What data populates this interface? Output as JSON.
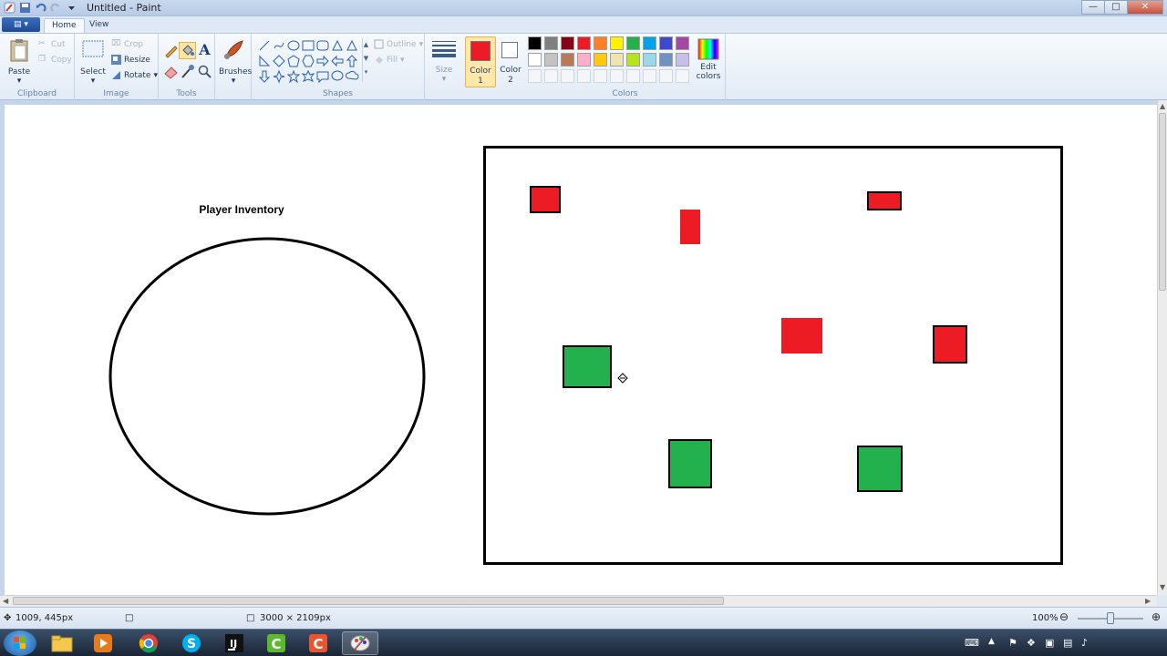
{
  "window": {
    "title": "Untitled - Paint"
  },
  "tabs": {
    "file_label": "▤ ▾",
    "home": "Home",
    "view": "View"
  },
  "ribbon": {
    "clipboard": {
      "group": "Clipboard",
      "paste": "Paste",
      "cut": "Cut",
      "copy": "Copy"
    },
    "image": {
      "group": "Image",
      "select": "Select",
      "crop": "Crop",
      "resize": "Resize",
      "rotate": "Rotate"
    },
    "tools": {
      "group": "Tools"
    },
    "brushes": {
      "label": "Brushes"
    },
    "shapes": {
      "group": "Shapes",
      "outline": "Outline",
      "fill": "Fill"
    },
    "size": {
      "label": "Size"
    },
    "color1": {
      "label": "Color",
      "num": "1",
      "value": "#ed1c24"
    },
    "color2": {
      "label": "Color",
      "num": "2",
      "value": "#ffffff"
    },
    "colors": {
      "group": "Colors",
      "edit_line1": "Edit",
      "edit_line2": "colors"
    },
    "palette_row1": [
      "#000000",
      "#7f7f7f",
      "#880015",
      "#ed1c24",
      "#ff7f27",
      "#fff200",
      "#22b14c",
      "#00a2e8",
      "#3f48cc",
      "#a349a4"
    ],
    "palette_row2": [
      "#ffffff",
      "#c3c3c3",
      "#b97a57",
      "#ffaec9",
      "#ffc90e",
      "#efe4b0",
      "#b5e61d",
      "#99d9ea",
      "#7092be",
      "#c8bfe7"
    ]
  },
  "canvas": {
    "heading": "Player Inventory",
    "colors": {
      "red": "#ed1c24",
      "green": "#22b14c",
      "outline": "#000000"
    }
  },
  "status": {
    "cursor_pos": "1009, 445px",
    "canvas_size": "3000 × 2109px",
    "zoom": "100%"
  }
}
